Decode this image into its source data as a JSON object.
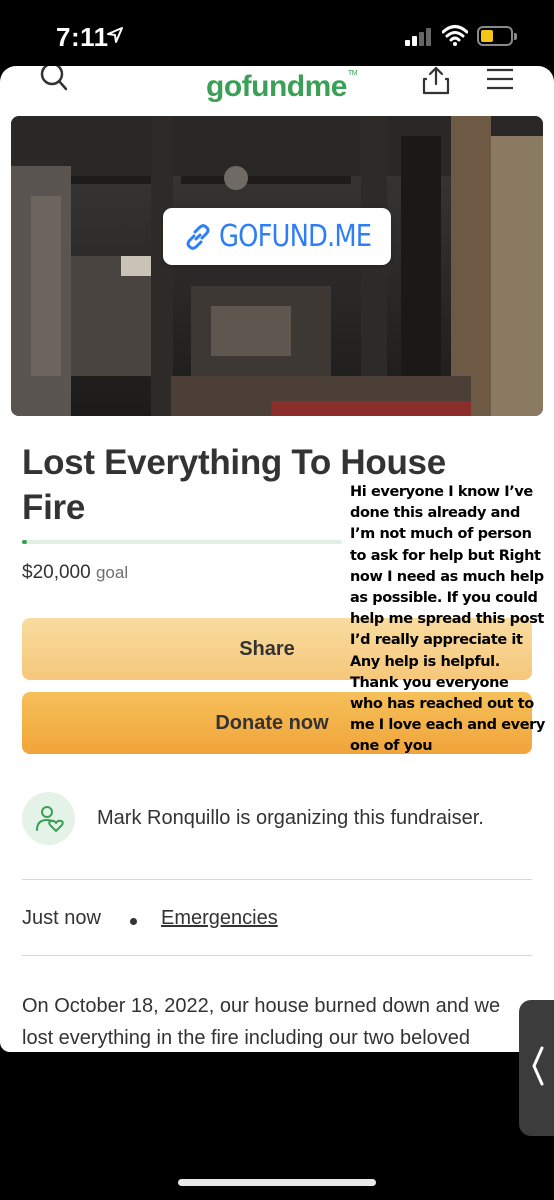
{
  "status_bar": {
    "time": "7:11",
    "icons": [
      "location-arrow-icon",
      "signal-icon",
      "wifi-icon",
      "battery-icon"
    ],
    "battery_color": "#f5c518"
  },
  "header": {
    "logo": "gofundme",
    "logo_tm": "TM",
    "icons": [
      "search-icon",
      "share-icon",
      "menu-icon"
    ]
  },
  "hero": {
    "sticker_text": "GOFUND.ME",
    "sticker_icon": "link-icon"
  },
  "campaign": {
    "title": "Lost Everything To House Fire",
    "amount": "$20,000",
    "goal_word": "goal",
    "progress_fraction": 0.01
  },
  "buttons": {
    "share": "Share",
    "donate": "Donate now"
  },
  "overlay_note": {
    "lines": [
      "Hi everyone I know I’ve",
      "done this already and",
      "I’m not much of person",
      "to ask for help but Right",
      "now I need as much help",
      "as possible.  If you could",
      "help me spread this post",
      "I’d really appreciate it",
      "Any help is helpful.",
      "Thank you everyone",
      "who has reached out to",
      "me I love each and every",
      "one of you"
    ]
  },
  "organizer": {
    "text": "Mark Ronquillo is organizing this fundraiser.",
    "icon": "organizer-heart-icon"
  },
  "meta": {
    "time": "Just now",
    "category": "Emergencies"
  },
  "story": {
    "lines": [
      "On October 18, 2022, our house burned down and we",
      "lost everything in the fire including our two beloved"
    ]
  },
  "colors": {
    "brand_green": "#3aa055",
    "share_button": "#f6c77a",
    "donate_button": "#f1a43a",
    "link_blue": "#2f7ef6"
  }
}
